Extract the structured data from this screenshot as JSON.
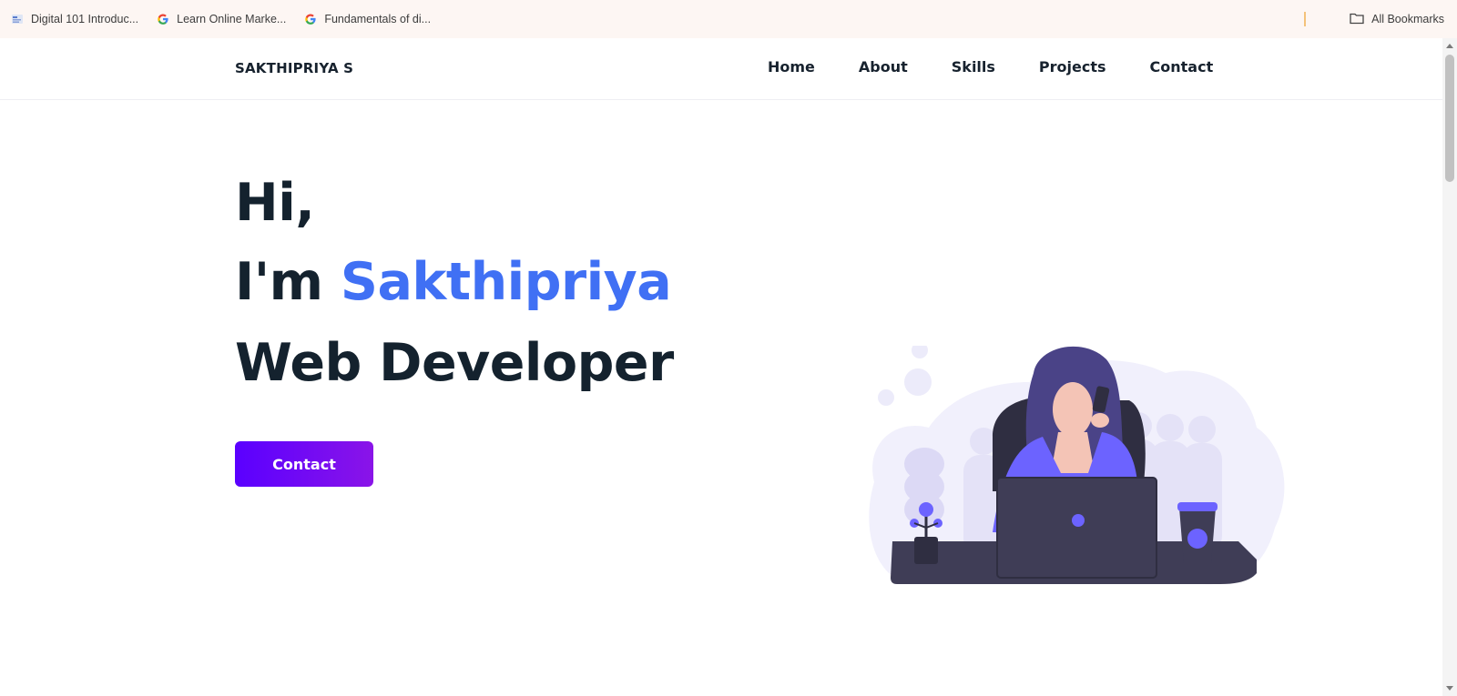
{
  "bookmarks": {
    "items": [
      {
        "label": "Digital 101 Introduc...",
        "icon": "site-favicon-icon"
      },
      {
        "label": "Learn Online Marke...",
        "icon": "google-icon"
      },
      {
        "label": "Fundamentals of di...",
        "icon": "google-icon"
      }
    ],
    "all_label": "All Bookmarks"
  },
  "header": {
    "logo": "SAKTHIPRIYA S",
    "nav": [
      "Home",
      "About",
      "Skills",
      "Projects",
      "Contact"
    ]
  },
  "hero": {
    "line1": "Hi,",
    "line2_prefix": "I'm ",
    "line2_name": "Sakthipriya",
    "line3": "Web Developer",
    "cta_label": "Contact"
  },
  "colors": {
    "accent": "#4070f4",
    "text": "#14222e",
    "button_start": "#5a00ff",
    "button_end": "#8a14e8"
  }
}
